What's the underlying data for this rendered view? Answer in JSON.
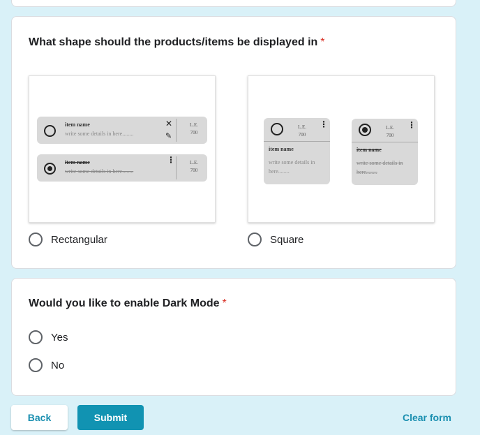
{
  "questions": {
    "shape": {
      "title": "What shape should the products/items be displayed in",
      "required_mark": "*",
      "preview_rect": {
        "item1": {
          "name": "item name",
          "desc": "write some details in here........",
          "price": "L.E.\n700",
          "close_icon": "close-icon",
          "edit_icon": "edit-icon"
        },
        "item2": {
          "name": "item name",
          "desc": "write some details in here........",
          "price": "L.E.\n700"
        }
      },
      "preview_square": {
        "item1": {
          "name": "item name",
          "desc": "write some details in here........",
          "price": "L.E.\n700"
        },
        "item2": {
          "name": "item name",
          "desc": "write some details in here........",
          "price": "L.E.\n700"
        }
      },
      "options": [
        "Rectangular",
        "Square"
      ]
    },
    "dark_mode": {
      "title": "Would you like to enable Dark Mode",
      "required_mark": "*",
      "options": [
        "Yes",
        "No"
      ]
    }
  },
  "actions": {
    "back_label": "Back",
    "submit_label": "Submit",
    "clear_label": "Clear form"
  },
  "colors": {
    "background": "#d9f1f8",
    "accent": "#1193b2",
    "required": "#d93025"
  }
}
